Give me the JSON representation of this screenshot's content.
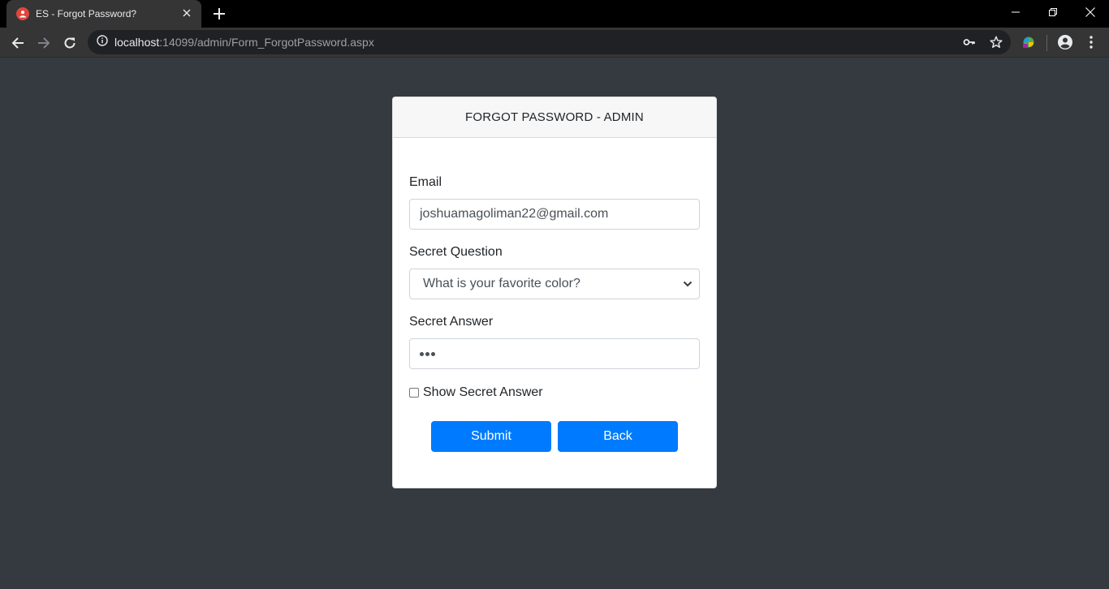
{
  "browser": {
    "tab_title": "ES - Forgot Password?",
    "url_host": "localhost",
    "url_path": ":14099/admin/Form_ForgotPassword.aspx"
  },
  "card": {
    "title": "FORGOT PASSWORD - ADMIN"
  },
  "form": {
    "email_label": "Email",
    "email_value": "joshuamagoliman22@gmail.com",
    "question_label": "Secret Question",
    "question_selected": "What is your favorite color?",
    "answer_label": "Secret Answer",
    "answer_masked_length": 3,
    "show_answer_label": "Show Secret Answer",
    "show_answer_checked": false,
    "submit_label": "Submit",
    "back_label": "Back"
  },
  "colors": {
    "page_background": "#343a40",
    "primary_button": "#007bff",
    "favicon": "#e0463e"
  },
  "icons": {
    "back": "arrow-left-icon",
    "forward": "arrow-right-icon",
    "reload": "reload-icon",
    "site_info": "info-icon",
    "key": "key-icon",
    "bookmark": "star-icon",
    "extension": "extension-icon",
    "profile": "account-circle-icon",
    "menu": "more-vert-icon"
  }
}
